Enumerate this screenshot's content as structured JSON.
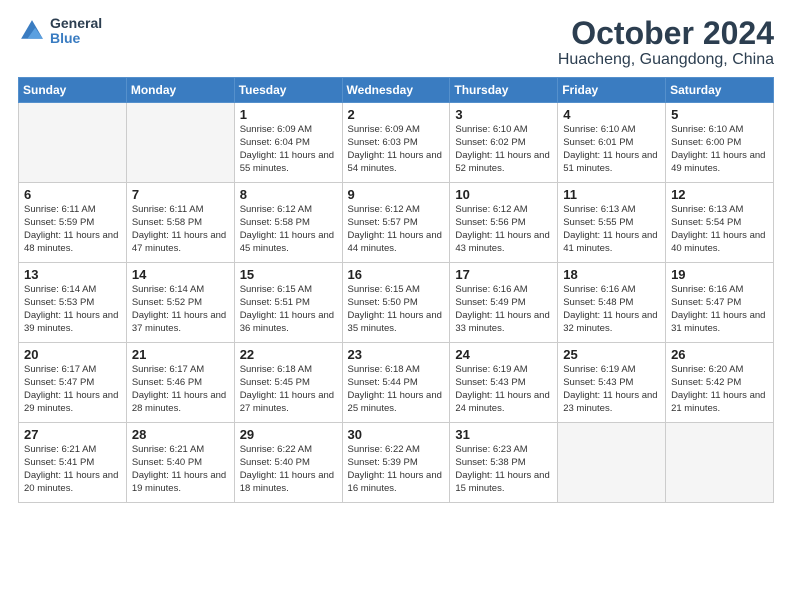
{
  "header": {
    "logo_line1": "General",
    "logo_line2": "Blue",
    "title": "October 2024",
    "subtitle": "Huacheng, Guangdong, China"
  },
  "weekdays": [
    "Sunday",
    "Monday",
    "Tuesday",
    "Wednesday",
    "Thursday",
    "Friday",
    "Saturday"
  ],
  "weeks": [
    [
      {
        "day": "",
        "empty": true
      },
      {
        "day": "",
        "empty": true
      },
      {
        "day": "1",
        "sunrise": "6:09 AM",
        "sunset": "6:04 PM",
        "daylight": "11 hours and 55 minutes."
      },
      {
        "day": "2",
        "sunrise": "6:09 AM",
        "sunset": "6:03 PM",
        "daylight": "11 hours and 54 minutes."
      },
      {
        "day": "3",
        "sunrise": "6:10 AM",
        "sunset": "6:02 PM",
        "daylight": "11 hours and 52 minutes."
      },
      {
        "day": "4",
        "sunrise": "6:10 AM",
        "sunset": "6:01 PM",
        "daylight": "11 hours and 51 minutes."
      },
      {
        "day": "5",
        "sunrise": "6:10 AM",
        "sunset": "6:00 PM",
        "daylight": "11 hours and 49 minutes."
      }
    ],
    [
      {
        "day": "6",
        "sunrise": "6:11 AM",
        "sunset": "5:59 PM",
        "daylight": "11 hours and 48 minutes."
      },
      {
        "day": "7",
        "sunrise": "6:11 AM",
        "sunset": "5:58 PM",
        "daylight": "11 hours and 47 minutes."
      },
      {
        "day": "8",
        "sunrise": "6:12 AM",
        "sunset": "5:58 PM",
        "daylight": "11 hours and 45 minutes."
      },
      {
        "day": "9",
        "sunrise": "6:12 AM",
        "sunset": "5:57 PM",
        "daylight": "11 hours and 44 minutes."
      },
      {
        "day": "10",
        "sunrise": "6:12 AM",
        "sunset": "5:56 PM",
        "daylight": "11 hours and 43 minutes."
      },
      {
        "day": "11",
        "sunrise": "6:13 AM",
        "sunset": "5:55 PM",
        "daylight": "11 hours and 41 minutes."
      },
      {
        "day": "12",
        "sunrise": "6:13 AM",
        "sunset": "5:54 PM",
        "daylight": "11 hours and 40 minutes."
      }
    ],
    [
      {
        "day": "13",
        "sunrise": "6:14 AM",
        "sunset": "5:53 PM",
        "daylight": "11 hours and 39 minutes."
      },
      {
        "day": "14",
        "sunrise": "6:14 AM",
        "sunset": "5:52 PM",
        "daylight": "11 hours and 37 minutes."
      },
      {
        "day": "15",
        "sunrise": "6:15 AM",
        "sunset": "5:51 PM",
        "daylight": "11 hours and 36 minutes."
      },
      {
        "day": "16",
        "sunrise": "6:15 AM",
        "sunset": "5:50 PM",
        "daylight": "11 hours and 35 minutes."
      },
      {
        "day": "17",
        "sunrise": "6:16 AM",
        "sunset": "5:49 PM",
        "daylight": "11 hours and 33 minutes."
      },
      {
        "day": "18",
        "sunrise": "6:16 AM",
        "sunset": "5:48 PM",
        "daylight": "11 hours and 32 minutes."
      },
      {
        "day": "19",
        "sunrise": "6:16 AM",
        "sunset": "5:47 PM",
        "daylight": "11 hours and 31 minutes."
      }
    ],
    [
      {
        "day": "20",
        "sunrise": "6:17 AM",
        "sunset": "5:47 PM",
        "daylight": "11 hours and 29 minutes."
      },
      {
        "day": "21",
        "sunrise": "6:17 AM",
        "sunset": "5:46 PM",
        "daylight": "11 hours and 28 minutes."
      },
      {
        "day": "22",
        "sunrise": "6:18 AM",
        "sunset": "5:45 PM",
        "daylight": "11 hours and 27 minutes."
      },
      {
        "day": "23",
        "sunrise": "6:18 AM",
        "sunset": "5:44 PM",
        "daylight": "11 hours and 25 minutes."
      },
      {
        "day": "24",
        "sunrise": "6:19 AM",
        "sunset": "5:43 PM",
        "daylight": "11 hours and 24 minutes."
      },
      {
        "day": "25",
        "sunrise": "6:19 AM",
        "sunset": "5:43 PM",
        "daylight": "11 hours and 23 minutes."
      },
      {
        "day": "26",
        "sunrise": "6:20 AM",
        "sunset": "5:42 PM",
        "daylight": "11 hours and 21 minutes."
      }
    ],
    [
      {
        "day": "27",
        "sunrise": "6:21 AM",
        "sunset": "5:41 PM",
        "daylight": "11 hours and 20 minutes."
      },
      {
        "day": "28",
        "sunrise": "6:21 AM",
        "sunset": "5:40 PM",
        "daylight": "11 hours and 19 minutes."
      },
      {
        "day": "29",
        "sunrise": "6:22 AM",
        "sunset": "5:40 PM",
        "daylight": "11 hours and 18 minutes."
      },
      {
        "day": "30",
        "sunrise": "6:22 AM",
        "sunset": "5:39 PM",
        "daylight": "11 hours and 16 minutes."
      },
      {
        "day": "31",
        "sunrise": "6:23 AM",
        "sunset": "5:38 PM",
        "daylight": "11 hours and 15 minutes."
      },
      {
        "day": "",
        "empty": true
      },
      {
        "day": "",
        "empty": true
      }
    ]
  ],
  "labels": {
    "sunrise": "Sunrise:",
    "sunset": "Sunset:",
    "daylight": "Daylight:"
  }
}
